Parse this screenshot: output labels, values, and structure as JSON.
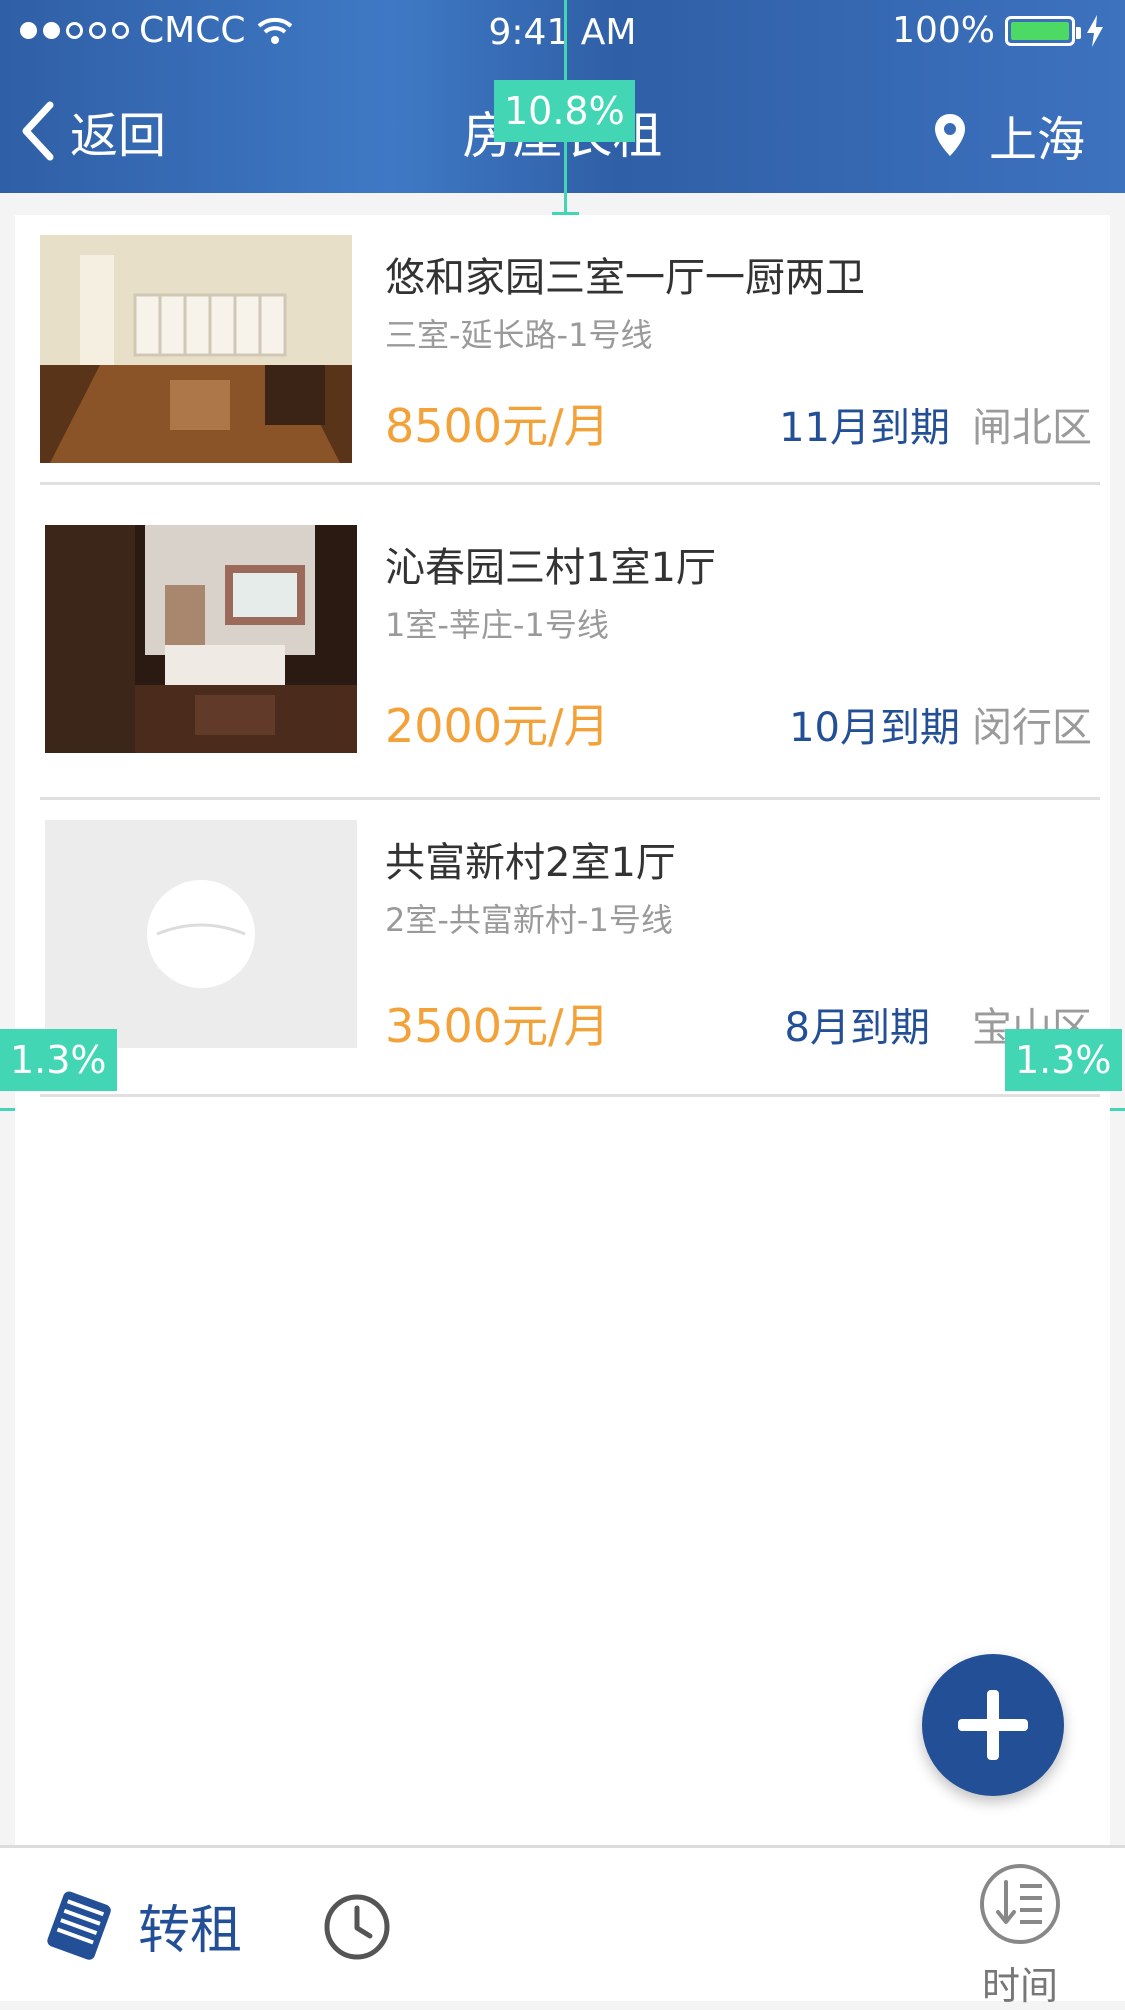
{
  "status_bar": {
    "carrier": "CMCC",
    "time": "9:41 AM",
    "battery": "100%"
  },
  "nav": {
    "back_label": "返回",
    "title": "房屋长租",
    "location": "上海"
  },
  "measurements": {
    "top_gap": "10.8%",
    "left_margin": "1.3%",
    "right_margin": "1.3%"
  },
  "listings": [
    {
      "title": "悠和家园三室一厅一厨两卫",
      "subtitle": "三室-延长路-1号线",
      "price": "8500元/月",
      "expire": "11月到期",
      "district": "闸北区",
      "thumb": "living-room-photo"
    },
    {
      "title": "沁春园三村1室1厅",
      "subtitle": "1室-莘庄-1号线",
      "price": "2000元/月",
      "expire": "10月到期",
      "district": "闵行区",
      "thumb": "bedroom-photo"
    },
    {
      "title": "共富新村2室1厅",
      "subtitle": "2室-共富新村-1号线",
      "price": "3500元/月",
      "expire": "8月到期",
      "district": "宝山区",
      "thumb": "placeholder-image"
    }
  ],
  "bottom_bar": {
    "rent_label": "转租",
    "time_label": "时间"
  },
  "colors": {
    "accent_blue": "#234f97",
    "price_orange": "#f3a23a",
    "badge_teal": "#43d6b4"
  }
}
